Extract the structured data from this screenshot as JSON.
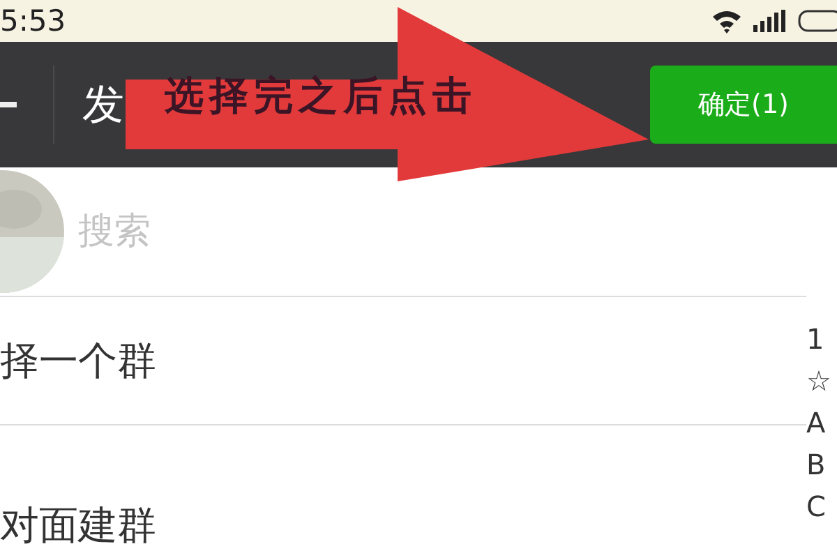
{
  "status_bar": {
    "time": "5:53"
  },
  "header": {
    "title": "发",
    "confirm_button": "确定(1)"
  },
  "annotation": {
    "text": "选择完之后点击"
  },
  "search": {
    "placeholder": "搜索"
  },
  "rows": [
    {
      "label": "择一个群"
    },
    {
      "label": "对面建群"
    }
  ],
  "index_bar": [
    "1",
    "☆",
    "A",
    "B",
    "C"
  ]
}
